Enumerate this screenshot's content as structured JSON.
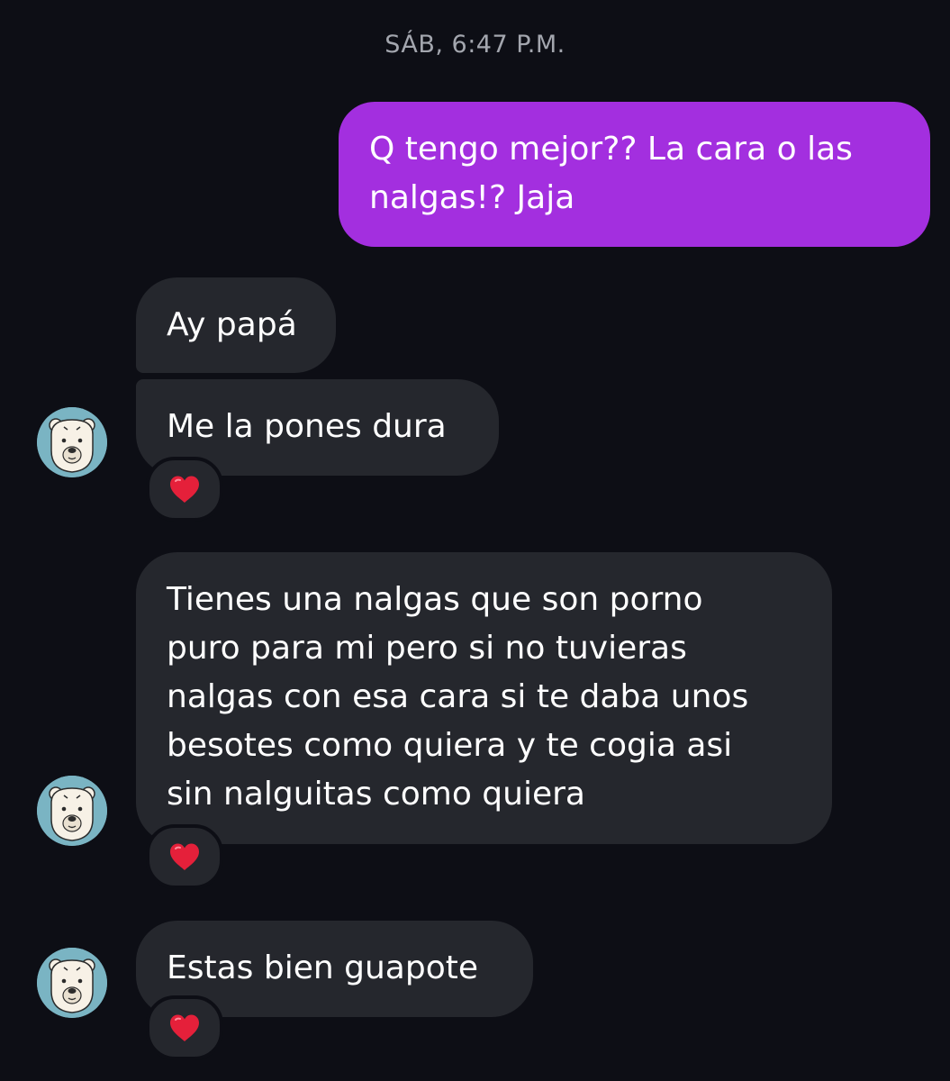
{
  "conversation": {
    "timestamp": "SÁB, 6:47 P.M.",
    "messages": [
      {
        "direction": "sent",
        "lines": [
          "Q tengo mejor?? La cara o las",
          "nalgas!? Jaja"
        ]
      },
      {
        "direction": "received",
        "lines": [
          "Ay papá"
        ]
      },
      {
        "direction": "received",
        "lines": [
          "Me la pones dura"
        ],
        "reaction": "heart-icon"
      },
      {
        "direction": "received",
        "lines": [
          "Tienes una nalgas que son porno",
          "puro para mi pero si no tuvieras",
          "nalgas con esa cara si te daba unos",
          "besotes como quiera y te cogia asi",
          "sin nalguitas como quiera"
        ],
        "reaction": "heart-icon"
      },
      {
        "direction": "received",
        "lines": [
          "Estas bien guapote"
        ],
        "reaction": "heart-icon"
      }
    ]
  },
  "colors": {
    "background": "#0d0e15",
    "sent_bubble": "#a32fdf",
    "received_bubble": "#25272d",
    "timestamp_text": "#a3a6ae",
    "avatar_bg": "#7ab4c3",
    "reaction_heart": "#e5203a"
  },
  "icons": {
    "avatar": "polar-bear-avatar-icon",
    "reaction": "heart-icon"
  }
}
